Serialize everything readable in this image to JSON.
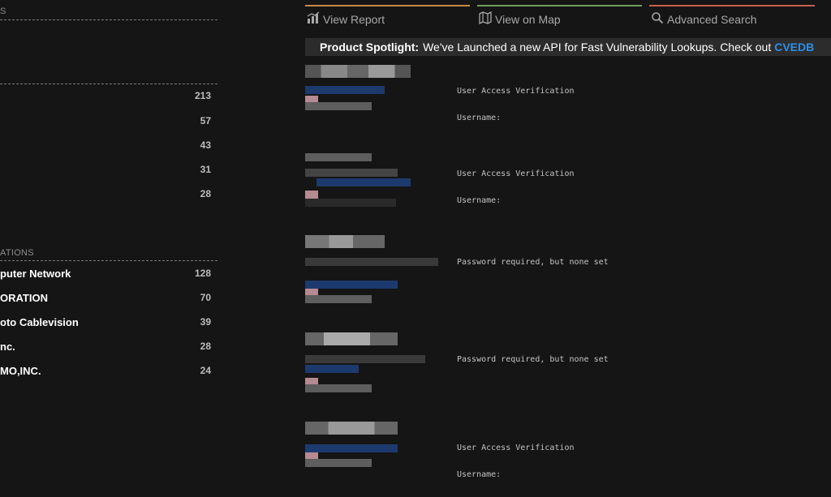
{
  "sidebar": {
    "section1_label": "S",
    "top_counts": [
      "213",
      "57",
      "43",
      "31",
      "28"
    ],
    "section2_label": "ATIONS",
    "organizations": [
      {
        "name": "puter Network",
        "count": "128"
      },
      {
        "name": "ORATION",
        "count": "70"
      },
      {
        "name": "oto Cablevision",
        "count": "39"
      },
      {
        "name": "nc.",
        "count": "28"
      },
      {
        "name": "MO,INC.",
        "count": "24"
      }
    ]
  },
  "tabs": [
    {
      "label": "View Report",
      "icon": "chart-icon",
      "color": "#c98a45"
    },
    {
      "label": "View on Map",
      "icon": "map-icon",
      "color": "#6f9e5a"
    },
    {
      "label": "Advanced Search",
      "icon": "search-icon",
      "color": "#c8604f"
    }
  ],
  "spotlight": {
    "title": "Product Spotlight:",
    "text": "We've Launched a new API for Fast Vulnerability Lookups. Check out",
    "link": "CVEDB"
  },
  "results": [
    {
      "line1": "User Access Verification",
      "line2": "Username:"
    },
    {
      "line1": "User Access Verification",
      "line2": "Username:"
    },
    {
      "line1": "Password required, but none set",
      "line2": ""
    },
    {
      "line1": "Password required, but none set",
      "line2": ""
    },
    {
      "line1": "User Access Verification",
      "line2": "Username:"
    }
  ]
}
